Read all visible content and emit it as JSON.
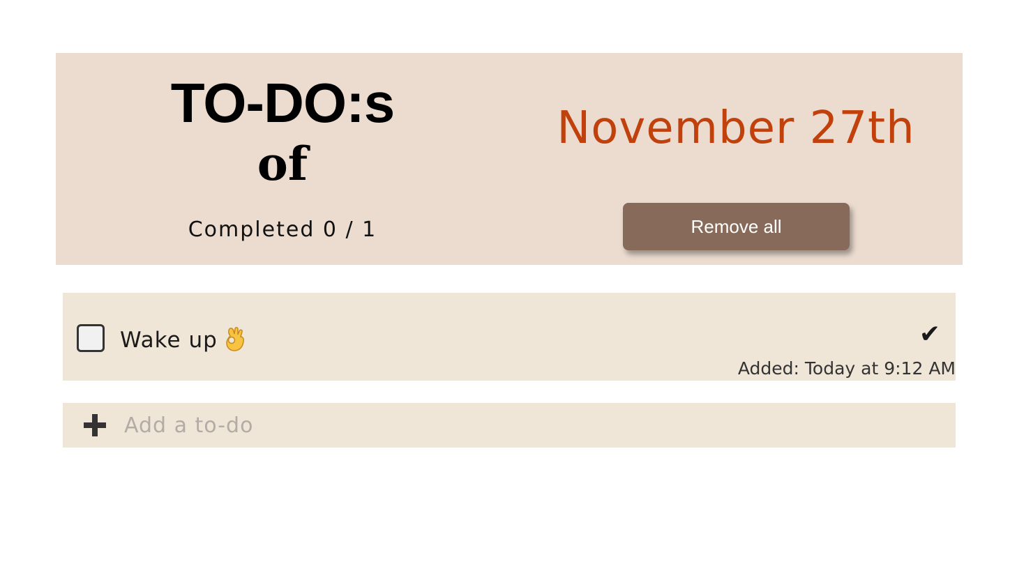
{
  "header": {
    "title": "TO-DO:s",
    "subtitle": "of",
    "completed_text": "Completed 0 / 1",
    "date": "November 27th",
    "remove_all_label": "Remove all"
  },
  "todos": [
    {
      "text": "Wake up",
      "emoji_icon": "ok-hand-emoji-icon",
      "completed": false,
      "done_mark": "✔",
      "added_text": "Added: Today at 9:12 AM"
    }
  ],
  "add_todo": {
    "placeholder": "Add a to-do",
    "value": "",
    "icon": "plus-icon"
  },
  "colors": {
    "header_bg": "#ebdccf",
    "item_bg": "#f0e6d8",
    "date_color": "#c0410c",
    "button_bg": "#876a59"
  }
}
